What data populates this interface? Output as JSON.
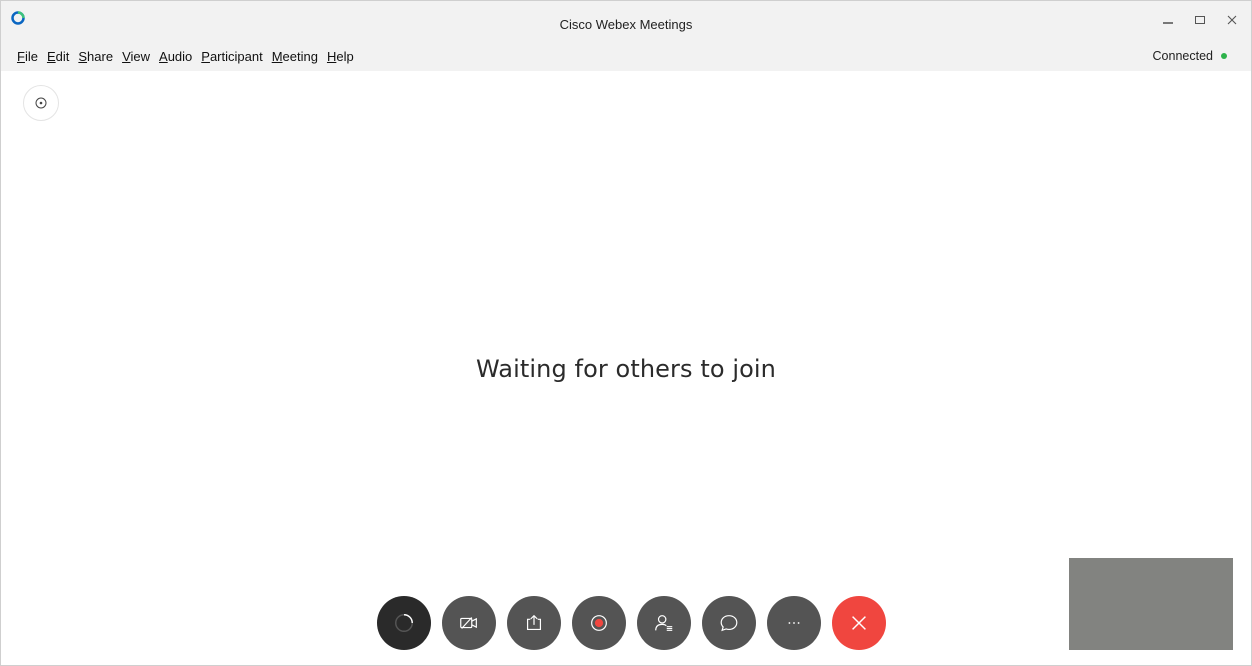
{
  "window": {
    "title": "Cisco Webex Meetings",
    "controls": {
      "minimize_label": "—",
      "maximize_label": "☐",
      "close_label": "✕"
    }
  },
  "menu": {
    "items": [
      {
        "underline": "F",
        "rest": "ile"
      },
      {
        "underline": "E",
        "rest": "dit"
      },
      {
        "underline": "S",
        "rest": "hare"
      },
      {
        "underline": "V",
        "rest": "iew"
      },
      {
        "underline": "A",
        "rest": "udio"
      },
      {
        "underline": "P",
        "rest": "articipant"
      },
      {
        "underline": "M",
        "rest": "eeting"
      },
      {
        "underline": "H",
        "rest": "elp"
      }
    ]
  },
  "status": {
    "text": "Connected",
    "color": "#2db24a"
  },
  "main": {
    "waiting_text": "Waiting for others to join"
  },
  "control_bar": {
    "buttons": [
      {
        "name": "mute-button",
        "icon": "spinner-icon"
      },
      {
        "name": "video-button",
        "icon": "video-off-icon"
      },
      {
        "name": "share-button",
        "icon": "share-icon"
      },
      {
        "name": "record-button",
        "icon": "record-icon"
      },
      {
        "name": "participants-button",
        "icon": "participants-icon"
      },
      {
        "name": "chat-button",
        "icon": "chat-icon"
      },
      {
        "name": "more-button",
        "icon": "more-icon"
      },
      {
        "name": "end-call-button",
        "icon": "close-icon"
      }
    ],
    "end_color": "#f0463f"
  }
}
